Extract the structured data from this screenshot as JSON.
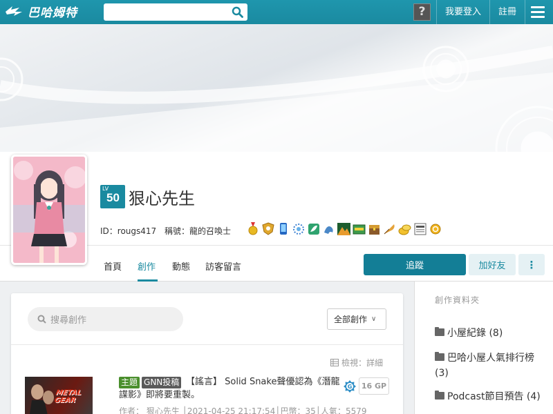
{
  "header": {
    "logo_text": "巴哈姆特",
    "search_placeholder": "",
    "login_label": "我要登入",
    "register_label": "註冊",
    "avatar_glyph": "?"
  },
  "profile": {
    "level_prefix": "LV",
    "level": "50",
    "name": "狠心先生",
    "id_text": "ID：rougs417",
    "title_text": "稱號：龍的召喚士",
    "medals": [
      "gold-medal-icon",
      "shield-badge-icon",
      "phone-badge-icon",
      "snowflake-badge-icon",
      "leaf-badge-icon",
      "dragon-badge-icon",
      "mountain-badge-icon",
      "chest-badge-icon",
      "treasure-badge-icon",
      "quill-badge-icon",
      "coins-badge-icon",
      "gnn-badge-icon",
      "coin-badge-icon"
    ]
  },
  "tabs": {
    "home": "首頁",
    "works": "創作",
    "status": "動態",
    "guestbook": "訪客留言",
    "follow": "追蹤",
    "add_friend": "加好友",
    "more": "⋮"
  },
  "works": {
    "search_placeholder": "搜尋創作",
    "filter": "全部創作",
    "view_toggle": "檢視：詳細",
    "post": {
      "tag_topic": "主題",
      "tag_gnn": "GNN投稿",
      "title": "【謠言】 Solid Snake聲優認為《潛龍諜影》即將要重製。",
      "gp": "16 GP",
      "meta": "作者： 狠心先生 │2021-04-25 21:17:54│巴幣：35│人氣：5579",
      "thumb_text": "METAL GEAR"
    }
  },
  "sidebar": {
    "title": "創作資料夾",
    "folders": [
      {
        "label": "小屋紀錄 (8)"
      },
      {
        "label": "巴哈小屋人氣排行榜 (3)"
      },
      {
        "label": "Podcast節目預告 (4)"
      }
    ]
  },
  "colors": {
    "brand": "#1a8aa0",
    "follow_bg": "#137e96",
    "topic_tag": "#4a8f2d",
    "gnn_tag": "#5a5a5a"
  }
}
